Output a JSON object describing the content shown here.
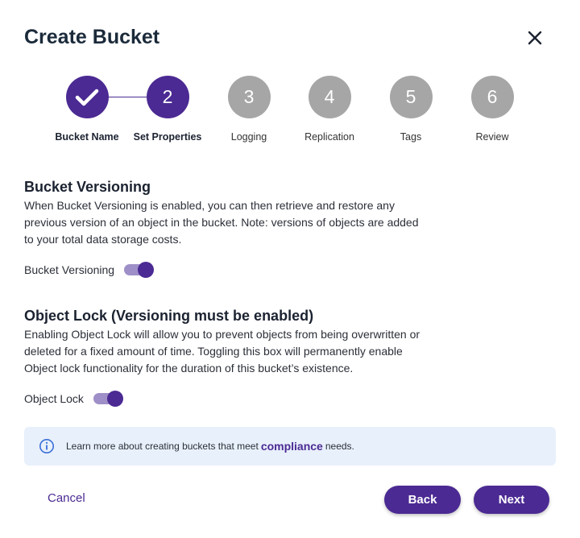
{
  "dialog": {
    "title": "Create Bucket"
  },
  "stepper": {
    "steps": [
      {
        "marker": "",
        "label": "Bucket Name",
        "state": "completed"
      },
      {
        "marker": "2",
        "label": "Set Properties",
        "state": "active"
      },
      {
        "marker": "3",
        "label": "Logging",
        "state": "inactive"
      },
      {
        "marker": "4",
        "label": "Replication",
        "state": "inactive"
      },
      {
        "marker": "5",
        "label": "Tags",
        "state": "inactive"
      },
      {
        "marker": "6",
        "label": "Review",
        "state": "inactive"
      }
    ]
  },
  "versioning": {
    "title": "Bucket Versioning",
    "description": "When Bucket Versioning is enabled, you can then retrieve and restore any previous version of an object in the bucket. Note: versions of objects are added to your total data storage costs.",
    "toggle_label": "Bucket Versioning",
    "enabled": true
  },
  "object_lock": {
    "title": "Object Lock (Versioning must be enabled)",
    "description": "Enabling Object Lock will allow you to prevent objects from being overwritten or deleted for a fixed amount of time. Toggling this box will permanently enable Object lock functionality for the duration of this bucket’s existence.",
    "toggle_label": "Object Lock",
    "enabled": true
  },
  "info": {
    "text_before": "Learn more about creating buckets that meet",
    "link": "compliance",
    "text_after": "needs."
  },
  "footer": {
    "cancel": "Cancel",
    "back": "Back",
    "next": "Next"
  },
  "colors": {
    "accent": "#4b2a93",
    "inactive_step": "#a6a6a6",
    "info_bg": "#e8f0fb"
  },
  "icons": {
    "close": "close-icon",
    "check": "check-icon",
    "info": "info-icon"
  }
}
